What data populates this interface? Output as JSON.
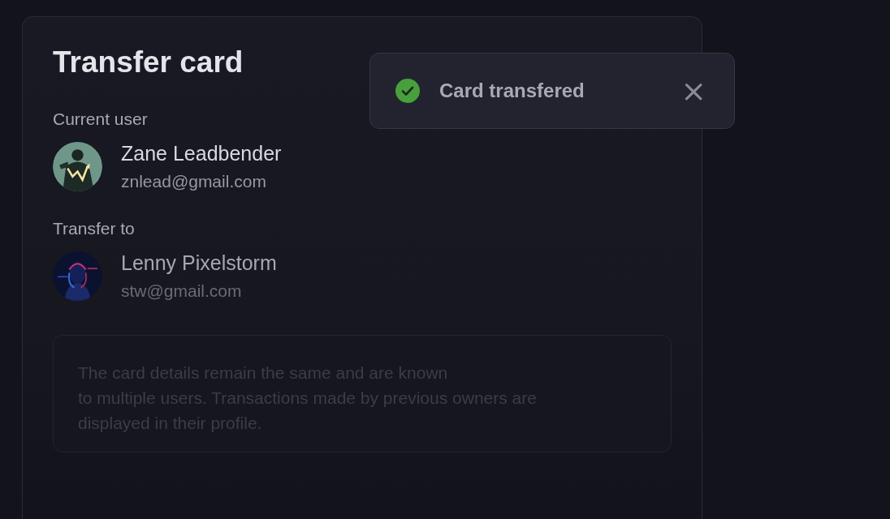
{
  "card": {
    "title": "Transfer card",
    "sections": [
      {
        "label": "Current user",
        "user": {
          "name": "Zane Leadbender",
          "email": "znlead@gmail.com"
        }
      },
      {
        "label": "Transfer to",
        "user": {
          "name": "Lenny Pixelstorm",
          "email": "stw@gmail.com"
        }
      }
    ],
    "note": "The card details remain the same and are known\nto multiple users. Transactions made by previous owners are\ndisplayed in their profile."
  },
  "toast": {
    "kind": "success",
    "message": "Card transfered",
    "close": "×"
  }
}
